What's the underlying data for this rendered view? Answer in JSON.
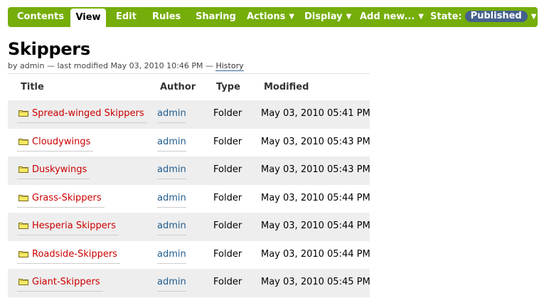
{
  "editbar": {
    "tabs": [
      {
        "label": "Contents"
      },
      {
        "label": "View"
      },
      {
        "label": "Edit"
      },
      {
        "label": "Rules"
      },
      {
        "label": "Sharing"
      }
    ],
    "menus": [
      {
        "label": "Actions",
        "arrow": "▼"
      },
      {
        "label": "Display",
        "arrow": "▼"
      },
      {
        "label": "Add new...",
        "arrow": "▼"
      }
    ],
    "state_label": "State:",
    "state_value": "Published",
    "state_arrow": "▼",
    "colors": {
      "bar": "#75ad0a",
      "badge": "#44618c"
    }
  },
  "page": {
    "title": "Skippers",
    "byline_text": "by admin — last modified May 03, 2010 10:46 PM —",
    "history_link": "History"
  },
  "table": {
    "headers": {
      "title": "Title",
      "author": "Author",
      "type": "Type",
      "modified": "Modified"
    },
    "rows": [
      {
        "title": "Spread-winged Skippers",
        "author": "admin",
        "type": "Folder",
        "modified": "May 03, 2010 05:41 PM",
        "icon": "folder-icon"
      },
      {
        "title": "Cloudywings",
        "author": "admin",
        "type": "Folder",
        "modified": "May 03, 2010 05:43 PM",
        "icon": "folder-icon"
      },
      {
        "title": "Duskywings",
        "author": "admin",
        "type": "Folder",
        "modified": "May 03, 2010 05:43 PM",
        "icon": "folder-icon"
      },
      {
        "title": "Grass-Skippers",
        "author": "admin",
        "type": "Folder",
        "modified": "May 03, 2010 05:44 PM",
        "icon": "folder-icon"
      },
      {
        "title": "Hesperia Skippers",
        "author": "admin",
        "type": "Folder",
        "modified": "May 03, 2010 05:44 PM",
        "icon": "folder-icon"
      },
      {
        "title": "Roadside-Skippers",
        "author": "admin",
        "type": "Folder",
        "modified": "May 03, 2010 05:44 PM",
        "icon": "folder-icon"
      },
      {
        "title": "Giant-Skippers",
        "author": "admin",
        "type": "Folder",
        "modified": "May 03, 2010 05:45 PM",
        "icon": "folder-icon"
      }
    ],
    "colors": {
      "link": "#cc0000",
      "author": "#205c90",
      "stripe": "#eeeeee"
    }
  }
}
